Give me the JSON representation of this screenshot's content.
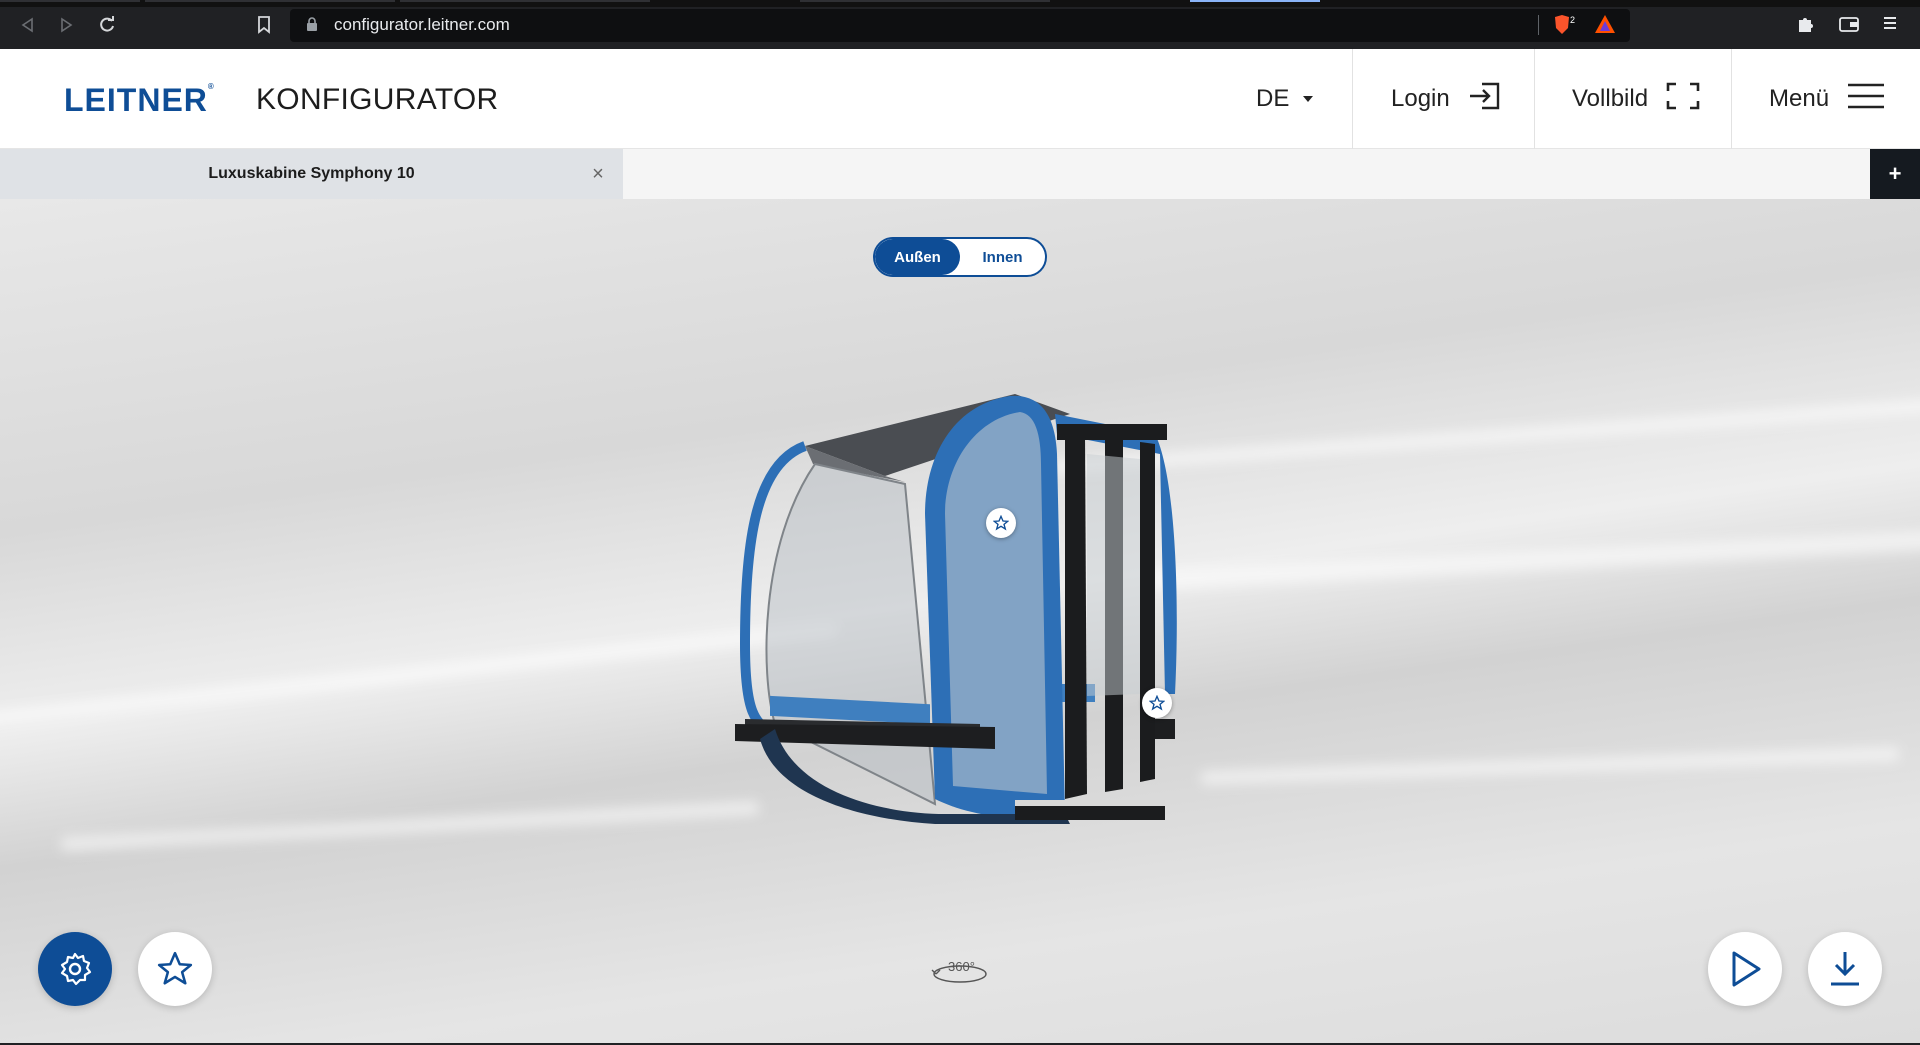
{
  "browser": {
    "url": "configurator.leitner.com",
    "extension_badge": "2"
  },
  "header": {
    "brand": "LEITNER",
    "app_title": "KONFIGURATOR",
    "language": "DE",
    "login_label": "Login",
    "fullscreen_label": "Vollbild",
    "menu_label": "Menü"
  },
  "tabs": {
    "items": [
      {
        "label": "Luxuskabine Symphony 10",
        "active": true
      }
    ],
    "close_symbol": "×",
    "add_symbol": "+"
  },
  "view_toggle": {
    "options": [
      "Außen",
      "Innen"
    ],
    "selected": "Außen"
  },
  "scene": {
    "rotate_hint": "360°",
    "hotspots": [
      "star-icon",
      "star-icon"
    ]
  },
  "controls": {
    "left": [
      "gear-icon",
      "star-icon"
    ],
    "right": [
      "play-icon",
      "download-icon"
    ]
  },
  "colors": {
    "brand": "#0e4d96",
    "cabin_frame": "#2d6fb6",
    "browser_chrome": "#202124"
  }
}
